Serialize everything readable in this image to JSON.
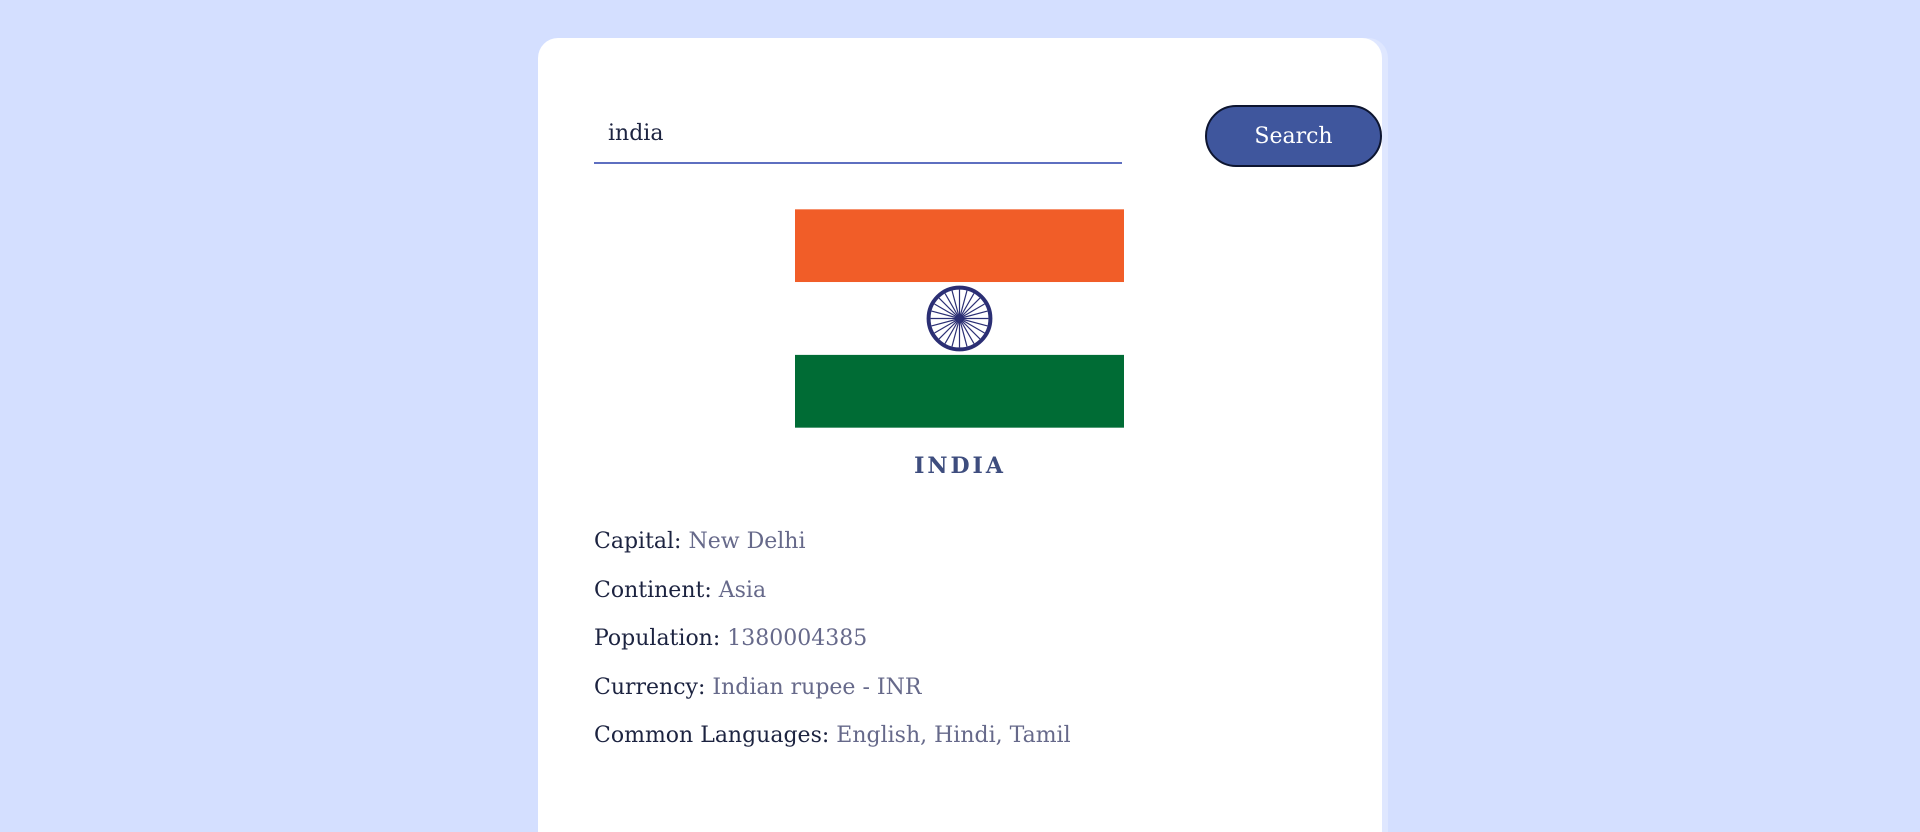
{
  "search": {
    "value": "india",
    "button_label": "Search"
  },
  "country": {
    "name": "INDIA",
    "flag_colors": {
      "saffron": "#f15d28",
      "white": "#ffffff",
      "green": "#006c35",
      "chakra": "#2b2f74"
    },
    "details": [
      {
        "label": "Capital:",
        "value": "New Delhi"
      },
      {
        "label": "Continent:",
        "value": "Asia"
      },
      {
        "label": "Population:",
        "value": "1380004385"
      },
      {
        "label": "Currency:",
        "value": "Indian rupee - INR"
      },
      {
        "label": "Common Languages:",
        "value": "English, Hindi, Tamil"
      }
    ]
  }
}
